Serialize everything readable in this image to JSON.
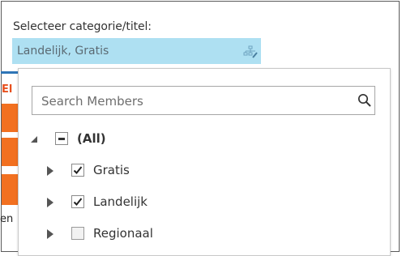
{
  "slicer": {
    "title": "Selecteer categorie/titel:",
    "selected_value": "Landelijk, Gratis",
    "filter_icon": "clear-filter-icon",
    "field_color": "#aee0f2"
  },
  "background": {
    "red_fragment": "El",
    "text_fragment": "en",
    "accent_orange": "#f27020",
    "accent_red": "#e7501e",
    "accent_blue": "#2e75b6"
  },
  "dropdown": {
    "search": {
      "placeholder": "Search Members",
      "value": "",
      "icon": "search-icon"
    },
    "tree": {
      "root": {
        "label": "(All)",
        "state": "partial",
        "expanded": true
      },
      "items": [
        {
          "label": "Gratis",
          "checked": true,
          "expanded": false
        },
        {
          "label": "Landelijk",
          "checked": true,
          "expanded": false
        },
        {
          "label": "Regionaal",
          "checked": false,
          "expanded": false
        }
      ]
    }
  }
}
